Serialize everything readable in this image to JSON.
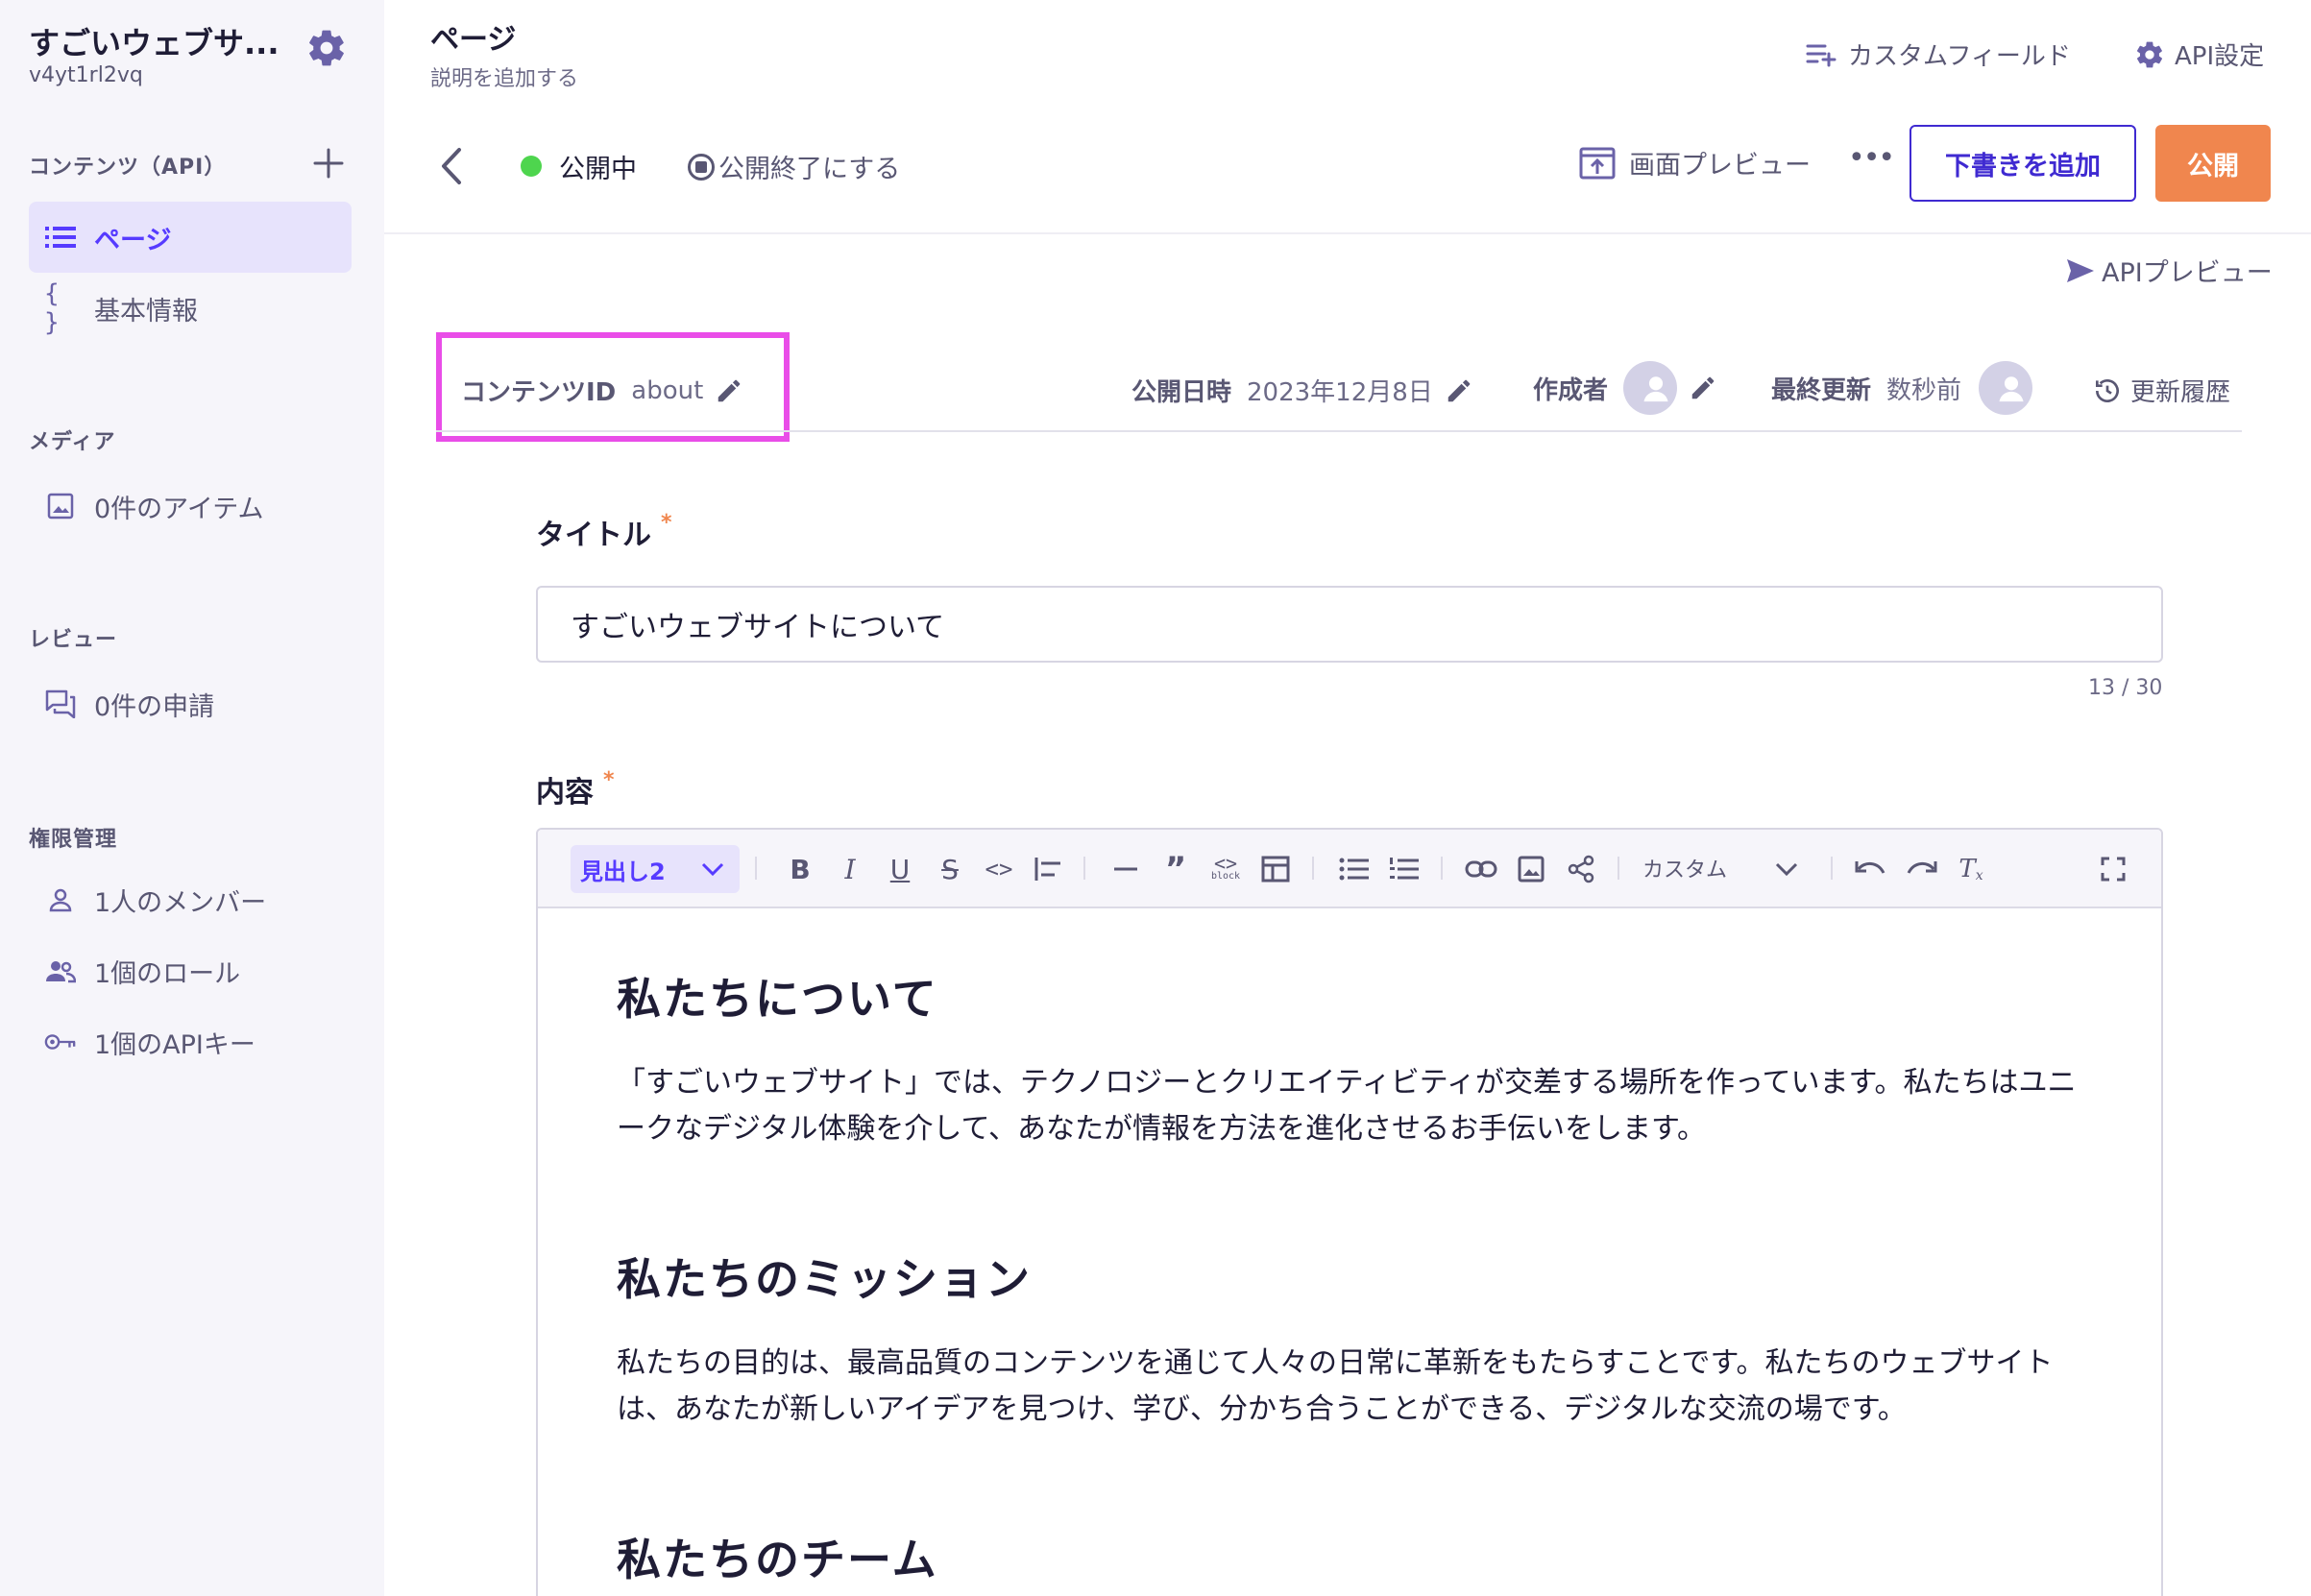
{
  "sidebar": {
    "service_name": "すごいウェブサ...",
    "service_id": "v4yt1rl2vq",
    "content_section": "コンテンツ（API）",
    "content_items": [
      {
        "label": "ページ",
        "icon": "list-icon"
      },
      {
        "label": "基本情報",
        "icon": "braces-icon"
      }
    ],
    "media_section": "メディア",
    "media_item": "0件のアイテム",
    "review_section": "レビュー",
    "review_item": "0件の申請",
    "perm_section": "権限管理",
    "perm_items": [
      {
        "label": "1人のメンバー",
        "icon": "person-icon"
      },
      {
        "label": "1個のロール",
        "icon": "people-icon"
      },
      {
        "label": "1個のAPIキー",
        "icon": "key-icon"
      }
    ]
  },
  "header": {
    "title": "ページ",
    "description": "説明を追加する",
    "custom_field": "カスタムフィールド",
    "api_settings": "API設定",
    "status": "公開中",
    "unpublish": "公開終了にする",
    "screen_preview": "画面プレビュー",
    "more": "•••",
    "add_draft": "下書きを追加",
    "publish": "公開",
    "api_preview": "APIプレビュー"
  },
  "meta": {
    "content_id_label": "コンテンツID",
    "content_id_value": "about",
    "published_label": "公開日時",
    "published_value": "2023年12月8日",
    "author_label": "作成者",
    "updated_label": "最終更新",
    "updated_value": "数秒前",
    "history": "更新履歴"
  },
  "form": {
    "title_label": "タイトル",
    "required_mark": "*",
    "title_value": "すごいウェブサイトについて",
    "title_counter": "13 / 30",
    "content_label": "内容"
  },
  "toolbar": {
    "heading_select": "見出し2",
    "custom": "カスタム"
  },
  "content": {
    "h1": "私たちについて",
    "p1": "「すごいウェブサイト」では、テクノロジーとクリエイティビティが交差する場所を作っています。私たちはユニークなデジタル体験を介して、あなたが情報を方法を進化させるお手伝いをします。",
    "h2": "私たちのミッション",
    "p2": "私たちの目的は、最高品質のコンテンツを通じて人々の日常に革新をもたらすことです。私たちのウェブサイトは、あなたが新しいアイデアを見つけ、学び、分かち合うことができる、デジタルな交流の場です。",
    "h3": "私たちのチーム"
  },
  "colors": {
    "accent": "#563bff",
    "publish": "#f0864e",
    "status_green": "#4ed54e",
    "highlight": "#e94de8"
  }
}
